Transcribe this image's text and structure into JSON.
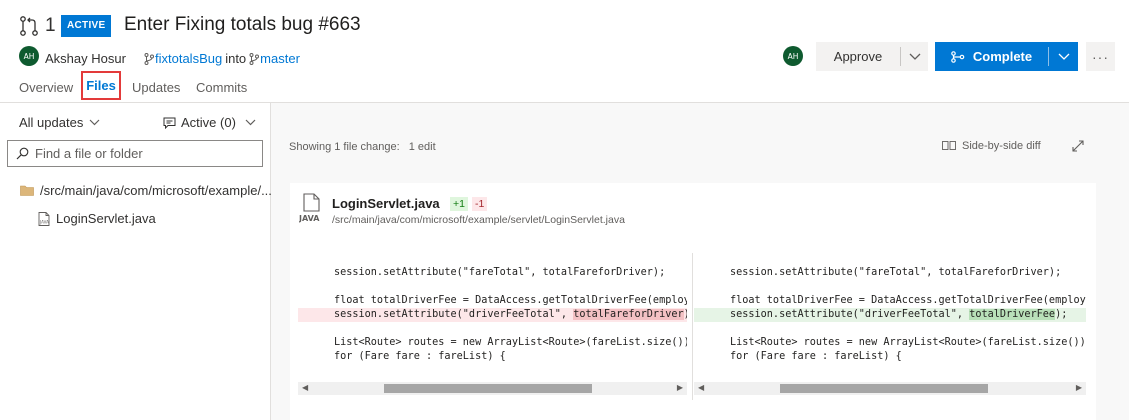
{
  "header": {
    "pr_count": "1",
    "status_badge": "ACTIVE",
    "title": "Enter Fixing totals bug #663",
    "author_initials": "AH",
    "author_name": "Akshay Hosur",
    "source_branch": "fixtotalsBug",
    "into_text": "into",
    "target_branch": "master",
    "reviewer_initials": "AH",
    "approve_label": "Approve",
    "complete_label": "Complete",
    "more_label": "···"
  },
  "tabs": [
    {
      "label": "Overview"
    },
    {
      "label": "Files",
      "selected": true
    },
    {
      "label": "Updates"
    },
    {
      "label": "Commits"
    }
  ],
  "sidebar": {
    "updates_filter": "All updates",
    "comments_filter": "Active (0)",
    "search_placeholder": "Find a file or folder",
    "folder_path": "/src/main/java/com/microsoft/example/...",
    "file_name": "LoginServlet.java"
  },
  "diff": {
    "showing_text": "Showing 1 file change:",
    "edit_count": "1 edit",
    "view_mode": "Side-by-side diff",
    "file_name": "LoginServlet.java",
    "additions": "+1",
    "deletions": "-1",
    "file_path": "/src/main/java/com/microsoft/example/servlet/LoginServlet.java",
    "file_type_label": "JAVA",
    "left_lines": [
      {
        "pre": "session.setAttribute(\"fareTotal\", totalFareforDriver);",
        "hl": "",
        "post": "",
        "type": "normal"
      },
      {
        "pre": "",
        "hl": "",
        "post": "",
        "type": "blank"
      },
      {
        "pre": "float totalDriverFee = DataAccess.getTotalDriverFee(employee",
        "hl": "",
        "post": "",
        "type": "normal"
      },
      {
        "pre": "session.setAttribute(\"driverFeeTotal\", ",
        "hl": "totalFareforDriver",
        "post": ");",
        "type": "del"
      },
      {
        "pre": "",
        "hl": "",
        "post": "",
        "type": "blank"
      },
      {
        "pre": "List<Route> routes = new ArrayList<Route>(fareList.size());",
        "hl": "",
        "post": "",
        "type": "normal"
      },
      {
        "pre": "for (Fare fare : fareList) {",
        "hl": "",
        "post": "",
        "type": "normal"
      }
    ],
    "right_lines": [
      {
        "pre": "session.setAttribute(\"fareTotal\", totalFareforDriver);",
        "hl": "",
        "post": "",
        "type": "normal"
      },
      {
        "pre": "",
        "hl": "",
        "post": "",
        "type": "blank"
      },
      {
        "pre": "float totalDriverFee = DataAccess.getTotalDriverFee(employee",
        "hl": "",
        "post": "",
        "type": "normal"
      },
      {
        "pre": "session.setAttribute(\"driverFeeTotal\", ",
        "hl": "totalDriverFee",
        "post": ");",
        "type": "add"
      },
      {
        "pre": "",
        "hl": "",
        "post": "",
        "type": "blank"
      },
      {
        "pre": "List<Route> routes = new ArrayList<Route>(fareList.size());",
        "hl": "",
        "post": "",
        "type": "normal"
      },
      {
        "pre": "for (Fare fare : fareList) {",
        "hl": "",
        "post": "",
        "type": "normal"
      }
    ]
  },
  "colors": {
    "accent": "#0078d4",
    "avatar": "#0e5a2f",
    "highlight_box": "#e33a3a",
    "deleted": "#fde7e9",
    "added": "#e6f4e6"
  }
}
